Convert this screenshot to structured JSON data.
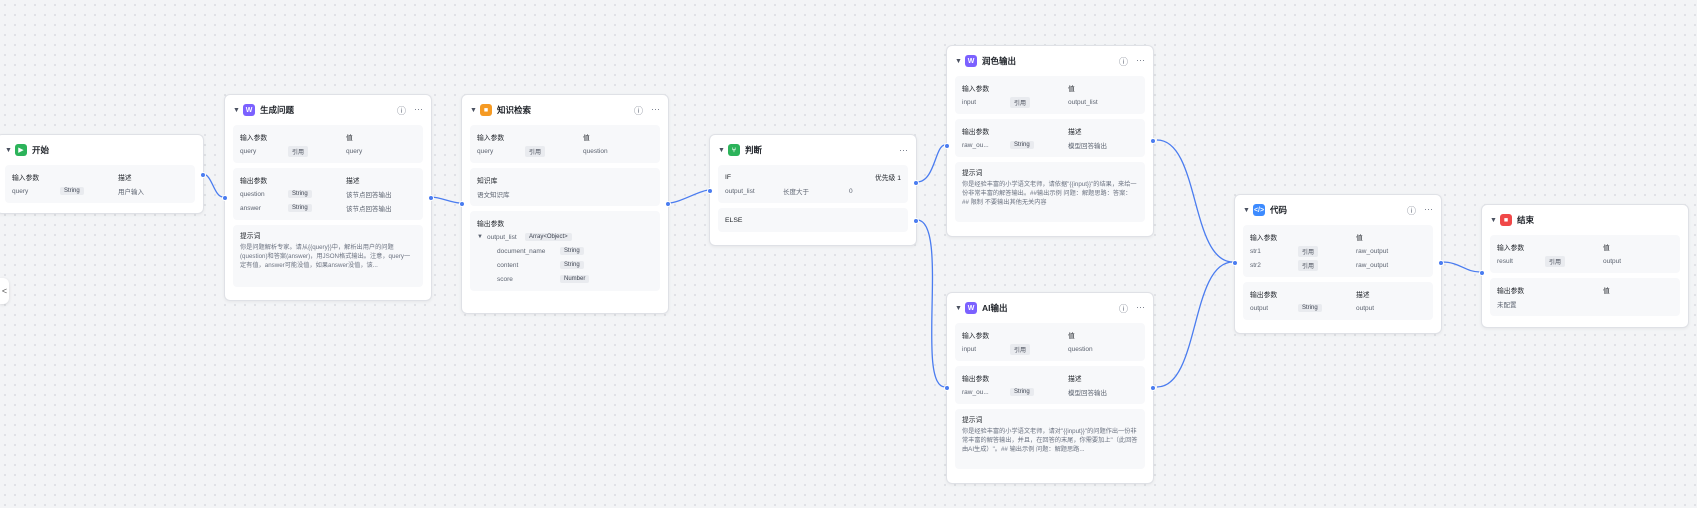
{
  "colors": {
    "edge": "#4a7cf0",
    "accent_purple": "#7b61ff",
    "accent_green": "#2cb35a",
    "accent_orange": "#f59a23",
    "accent_blue": "#3d8bff",
    "accent_red": "#f04848"
  },
  "collapse_icon": "<",
  "start": {
    "title": "开始",
    "in_label": "输入参数",
    "desc_label": "描述",
    "param": "query",
    "type": "String",
    "desc": "用户输入"
  },
  "gen": {
    "title": "生成问题",
    "in_label": "输入参数",
    "val_label": "值",
    "in_name": "query",
    "ref": "引用",
    "in_val": "query",
    "out_label": "输出参数",
    "desc_label": "描述",
    "outs": [
      {
        "name": "question",
        "type": "String",
        "desc": "该节点回答输出"
      },
      {
        "name": "answer",
        "type": "String",
        "desc": "该节点回答输出"
      }
    ],
    "prompt_label": "提示词",
    "prompt": "你是问题解析专家。请从{{query}}中，解析出用户的问题(question)和答案(answer)，用JSON格式输出。注意，query一定有值，answer可能没值，如果answer没值，该..."
  },
  "kb": {
    "title": "知识检索",
    "in_label": "输入参数",
    "val_label": "值",
    "in_name": "query",
    "ref": "引用",
    "in_val": "question",
    "kb_label": "知识库",
    "kb_name": "语文知识库",
    "out_label": "输出参数",
    "out_name": "output_list",
    "out_type": "Array<Object>",
    "subs": [
      {
        "name": "document_name",
        "type": "String"
      },
      {
        "name": "content",
        "type": "String"
      },
      {
        "name": "score",
        "type": "Number"
      }
    ]
  },
  "judge": {
    "title": "判断",
    "if": "IF",
    "priority": "优先级 1",
    "cond_param": "output_list",
    "cond_op": "长度大于",
    "cond_val": "0",
    "else": "ELSE"
  },
  "polish": {
    "title": "润色输出",
    "in_label": "输入参数",
    "val_label": "值",
    "in_name": "input",
    "ref": "引用",
    "in_val": "output_list",
    "out_label": "输出参数",
    "desc_label": "描述",
    "out_name": "raw_ou...",
    "out_type": "String",
    "out_desc": "模型回答输出",
    "prompt_label": "提示词",
    "prompt": "你是经验丰富的小学语文老师，请依据\"{{input}}\"的结果，来给一份非常丰富的解答输出。##输出示例 问题：解题思路：答案：## 限制 不要输出其他无关内容"
  },
  "ai": {
    "title": "AI输出",
    "in_label": "输入参数",
    "val_label": "值",
    "in_name": "input",
    "ref": "引用",
    "in_val": "question",
    "out_label": "输出参数",
    "desc_label": "描述",
    "out_name": "raw_ou...",
    "out_type": "String",
    "out_desc": "模型回答输出",
    "prompt_label": "提示词",
    "prompt": "你是经验丰富的小学语文老师，请对\"{{input}}\"的问题作出一份非常丰富的解答输出，并且，在回答的末尾，你需要加上\"（此回答由AI生成）\"。## 输出示例 问题：解题思路..."
  },
  "code": {
    "title": "代码",
    "in_label": "输入参数",
    "val_label": "值",
    "ins": [
      {
        "name": "str1",
        "ref": "引用",
        "val": "raw_output"
      },
      {
        "name": "str2",
        "ref": "引用",
        "val": "raw_output"
      }
    ],
    "out_label": "输出参数",
    "desc_label": "描述",
    "out_name": "output",
    "out_type": "String",
    "out_desc": "output"
  },
  "end": {
    "title": "结束",
    "in_label": "输入参数",
    "val_label": "值",
    "in_name": "result",
    "ref": "引用",
    "in_val": "output",
    "out_label": "输出参数",
    "out_val_label": "值",
    "out_empty": "未配置"
  }
}
